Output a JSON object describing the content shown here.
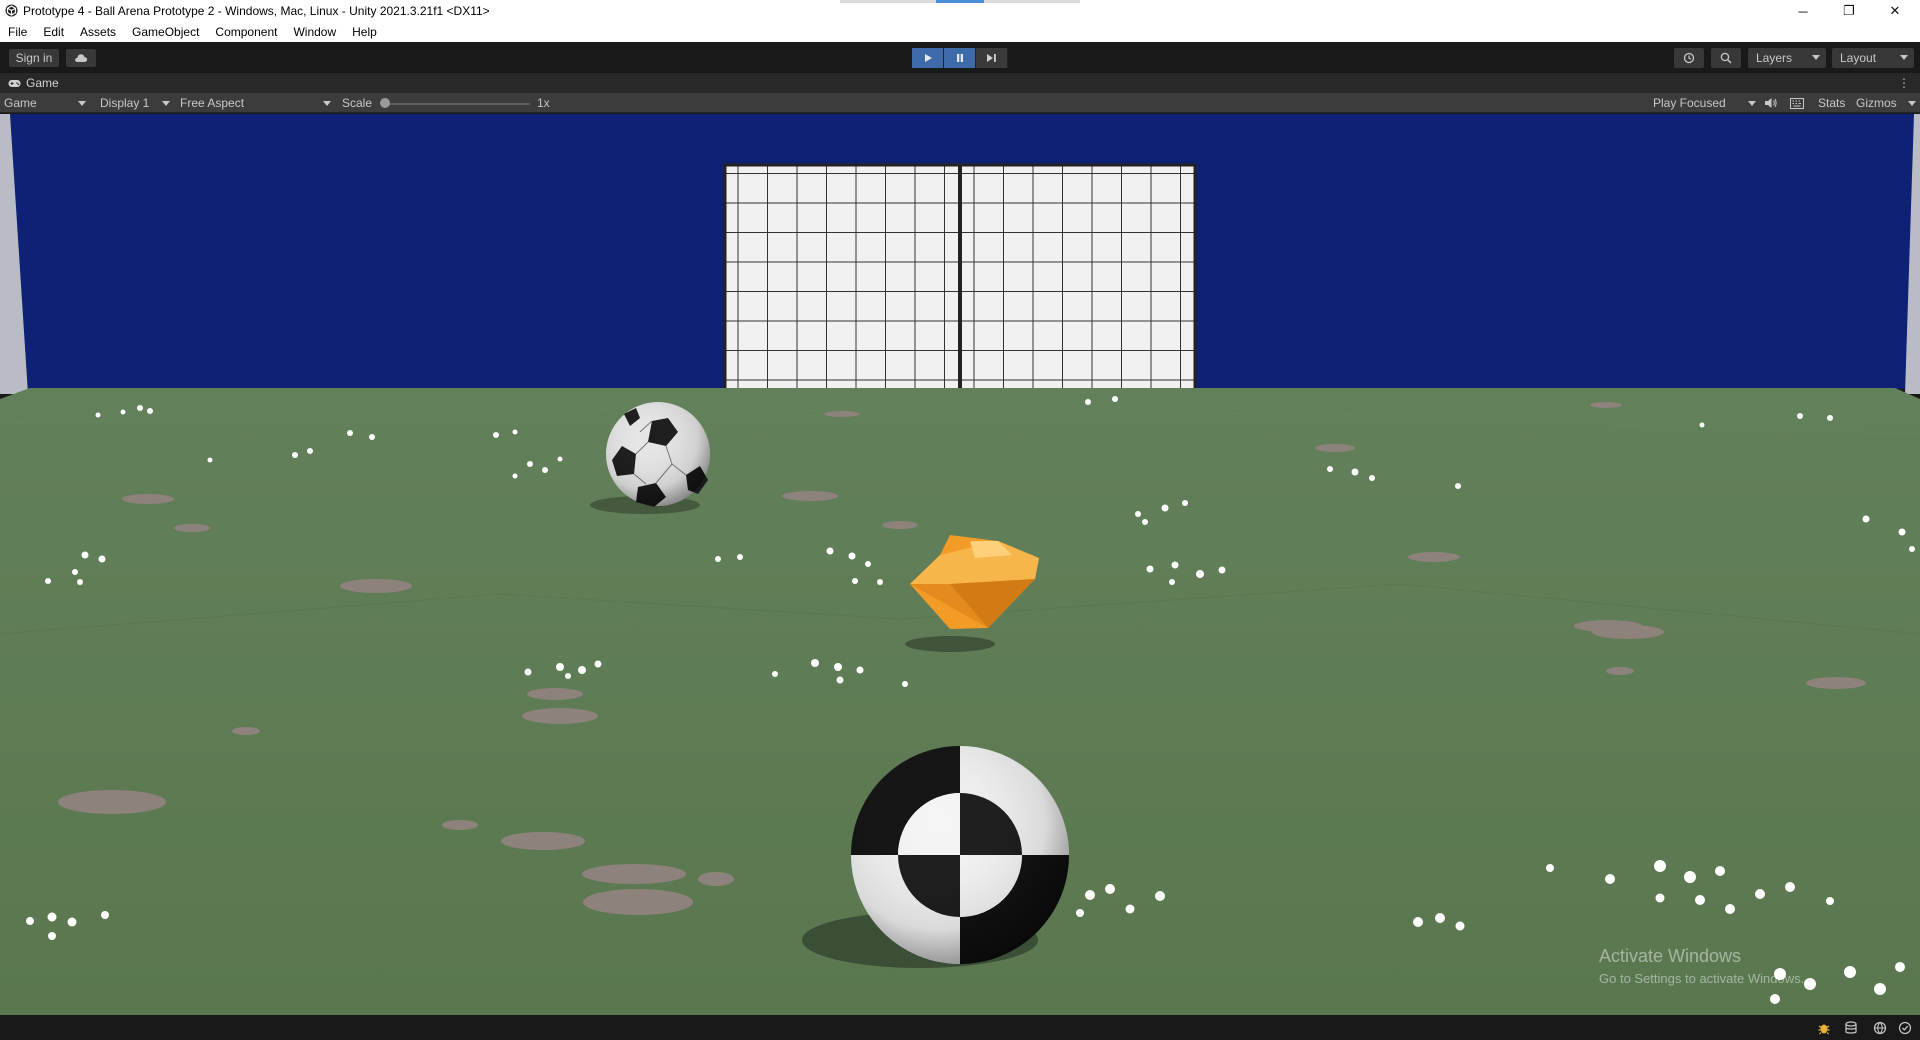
{
  "window": {
    "title": "Prototype 4 - Ball Arena Prototype 2 - Windows, Mac, Linux - Unity 2021.3.21f1 <DX11>",
    "controls": {
      "minimize": "─",
      "restore": "❐",
      "close": "✕"
    }
  },
  "menu": {
    "items": [
      "File",
      "Edit",
      "Assets",
      "GameObject",
      "Component",
      "Window",
      "Help"
    ]
  },
  "toolbar": {
    "sign_in": "Sign in",
    "cloud_icon": "cloud-icon",
    "play_state": "playing",
    "layers": "Layers",
    "layout": "Layout"
  },
  "tab": {
    "label": "Game",
    "icon": "gamepad-icon"
  },
  "game_toolbar": {
    "mode": "Game",
    "display": "Display 1",
    "aspect": "Free Aspect",
    "scale_label": "Scale",
    "scale_value": "1x",
    "scale_level": 0,
    "play_mode": "Play Focused",
    "stats": "Stats",
    "gizmos": "Gizmos"
  },
  "watermark": {
    "line1": "Activate Windows",
    "line2": "Go to Settings to activate Windows."
  },
  "colors": {
    "sky": "#0e2175",
    "ground": "#5d7a52",
    "gem": "#f29b26",
    "play_active": "#3d6aa8"
  }
}
